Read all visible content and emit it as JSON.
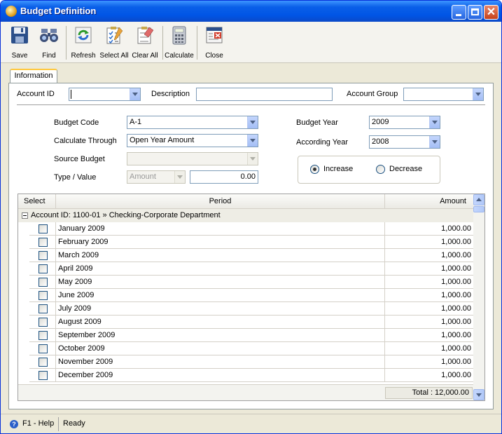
{
  "window": {
    "title": "Budget Definition",
    "close_glyph": "✕"
  },
  "toolbar": {
    "save": "Save",
    "find": "Find",
    "refresh": "Refresh",
    "select_all": "Select All",
    "clear_all": "Clear All",
    "calculate": "Calculate",
    "close": "Close"
  },
  "tabs": [
    {
      "label": "Information"
    }
  ],
  "filters": {
    "account_id_label": "Account ID",
    "account_id_value": "",
    "description_label": "Description",
    "description_value": "",
    "account_group_label": "Account Group",
    "account_group_value": ""
  },
  "form": {
    "budget_code_label": "Budget Code",
    "budget_code_value": "A-1",
    "calculate_through_label": "Calculate Through",
    "calculate_through_value": "Open Year Amount",
    "source_budget_label": "Source Budget",
    "source_budget_value": "",
    "type_value_label": "Type / Value",
    "type_value": "Amount",
    "value_amount": "0.00",
    "budget_year_label": "Budget Year",
    "budget_year_value": "2009",
    "according_year_label": "According Year",
    "according_year_value": "2008",
    "increase_label": "Increase",
    "decrease_label": "Decrease",
    "selected_option": "Increase"
  },
  "grid": {
    "columns": [
      "Select",
      "Period",
      "Amount"
    ],
    "group_label": "Account ID: 1100-01 » Checking-Corporate Department",
    "rows": [
      {
        "period": "January 2009",
        "amount": "1,000.00"
      },
      {
        "period": "February 2009",
        "amount": "1,000.00"
      },
      {
        "period": "March 2009",
        "amount": "1,000.00"
      },
      {
        "period": "April 2009",
        "amount": "1,000.00"
      },
      {
        "period": "May 2009",
        "amount": "1,000.00"
      },
      {
        "period": "June 2009",
        "amount": "1,000.00"
      },
      {
        "period": "July 2009",
        "amount": "1,000.00"
      },
      {
        "period": "August 2009",
        "amount": "1,000.00"
      },
      {
        "period": "September 2009",
        "amount": "1,000.00"
      },
      {
        "period": "October 2009",
        "amount": "1,000.00"
      },
      {
        "period": "November 2009",
        "amount": "1,000.00"
      },
      {
        "period": "December 2009",
        "amount": "1,000.00"
      }
    ],
    "total": "Total : 12,000.00"
  },
  "status": {
    "help": "F1 - Help",
    "help_glyph": "?",
    "message": "Ready"
  }
}
